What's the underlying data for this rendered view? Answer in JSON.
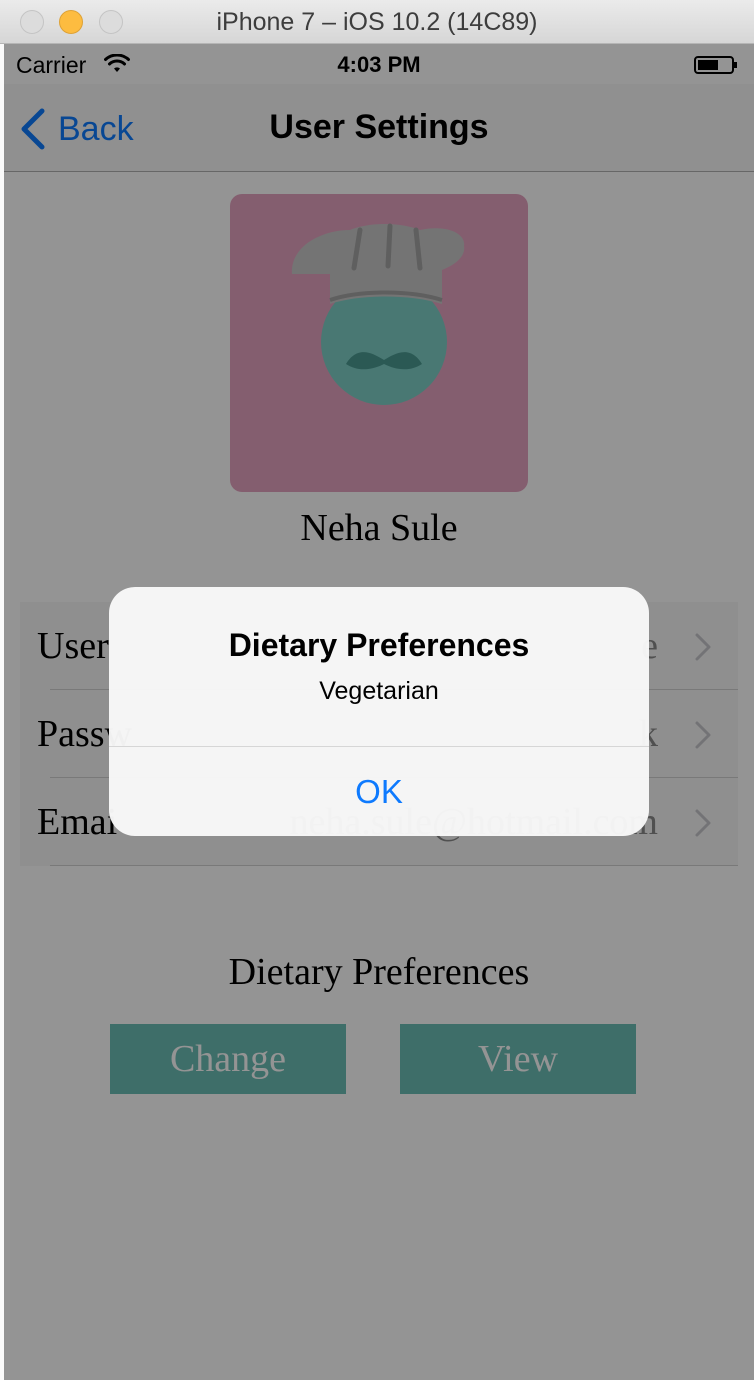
{
  "window": {
    "title": "iPhone 7 – iOS 10.2 (14C89)"
  },
  "status_bar": {
    "carrier": "Carrier",
    "time": "4:03 PM"
  },
  "nav": {
    "back_label": "Back",
    "title": "User Settings"
  },
  "profile": {
    "name": "Neha Sule",
    "avatar_icon": "chef-avatar-icon",
    "avatar_color": "#e3a3c0"
  },
  "settings": {
    "rows": [
      {
        "label": "User",
        "value": "e"
      },
      {
        "label": "Passw",
        "value": "k"
      },
      {
        "label": "Emai",
        "value": "neha.sule@hotmail.com"
      }
    ]
  },
  "dietary": {
    "heading": "Dietary Preferences",
    "change_label": "Change",
    "view_label": "View",
    "button_color": "#6cbdb5"
  },
  "alert": {
    "title": "Dietary Preferences",
    "message": "Vegetarian",
    "ok_label": "OK"
  },
  "colors": {
    "ios_blue": "#0e7afe"
  }
}
